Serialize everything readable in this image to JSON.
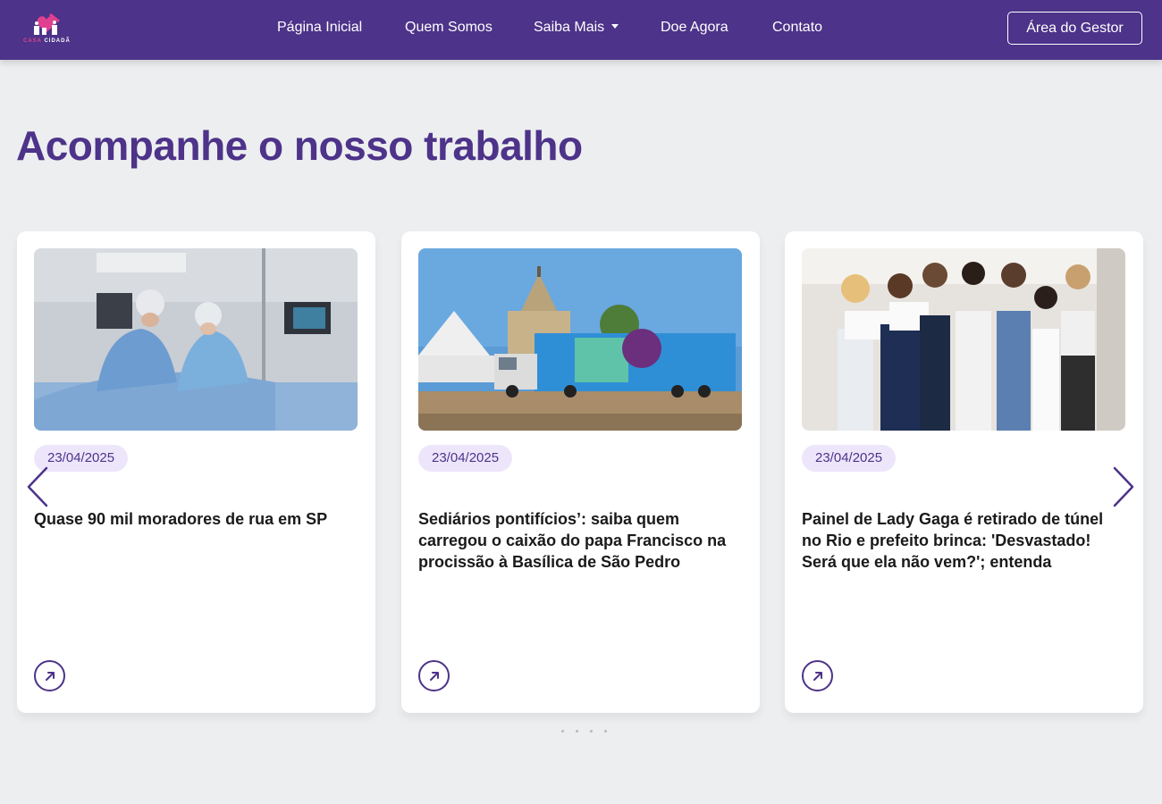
{
  "header": {
    "logo_text_pink": "CASA",
    "logo_text_white": "CIDADÃ",
    "nav": [
      {
        "label": "Página Inicial"
      },
      {
        "label": "Quem Somos"
      },
      {
        "label": "Saiba Mais"
      },
      {
        "label": "Doe Agora"
      },
      {
        "label": "Contato"
      }
    ],
    "gestor_label": "Área do Gestor"
  },
  "colors": {
    "brand_purple": "#4d3389",
    "badge_bg": "#ede6fb",
    "page_bg": "#edeef0"
  },
  "section": {
    "title": "Acompanhe o nosso trabalho"
  },
  "cards": [
    {
      "date": "23/04/2025",
      "title": "Quase 90 mil moradores de rua em SP",
      "image": "surgery-photo"
    },
    {
      "date": "23/04/2025",
      "title": "Sediários pontifícios’: saiba quem carregou o caixão do papa Francisco na procissão à Basílica de São Pedro",
      "image": "mobile-clinic-truck-photo"
    },
    {
      "date": "23/04/2025",
      "title": "Painel de Lady Gaga é retirado de túnel no Rio e prefeito brinca: 'Desvastado! Será que ela não vem?'; entenda",
      "image": "group-certificate-photo"
    }
  ],
  "carousel": {
    "icons": {
      "prev": "chevron-left-icon",
      "next": "chevron-right-icon",
      "card_link": "arrow-up-right-icon"
    },
    "dot_count": 4
  }
}
